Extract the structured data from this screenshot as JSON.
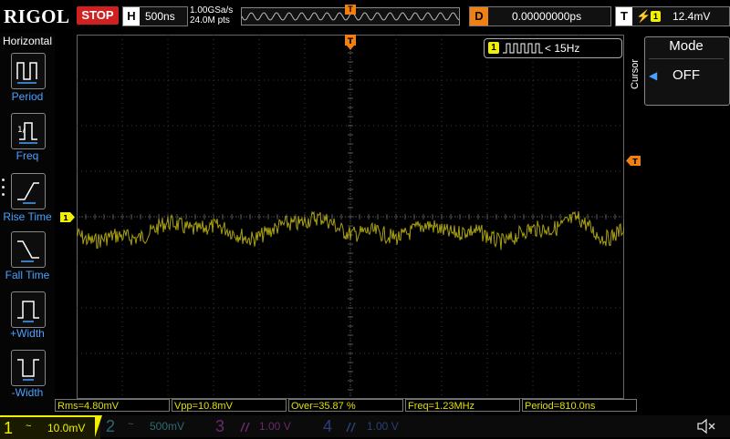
{
  "brand": "RIGOL",
  "run_state": "STOP",
  "timebase": {
    "key": "H",
    "value": "500ns"
  },
  "sampling": {
    "rate": "1.00GSa/s",
    "points": "24.0M pts"
  },
  "delay": {
    "key": "D",
    "value": "0.00000000ps"
  },
  "trigger": {
    "key": "T",
    "channel": "1",
    "level": "12.4mV",
    "marker": "T",
    "edge_glyph": "⚡"
  },
  "left_menu": {
    "title": "Horizontal",
    "items": [
      {
        "label": "Period"
      },
      {
        "label": "Freq"
      },
      {
        "label": "Rise Time"
      },
      {
        "label": "Fall Time"
      },
      {
        "label": "+Width"
      },
      {
        "label": "-Width"
      }
    ]
  },
  "cursor_panel": {
    "tab": "Cursor",
    "mode_label": "Mode",
    "mode_value": "OFF"
  },
  "measure_indicator": {
    "channel": "1",
    "value": "< 15Hz"
  },
  "ch1_marker": "1",
  "measurements": [
    {
      "text": "Rms=4.80mV"
    },
    {
      "text": "Vpp=10.8mV"
    },
    {
      "text": "Over=35.87 %"
    },
    {
      "text": "Freq=1.23MHz"
    },
    {
      "text": "Period=810.0ns"
    }
  ],
  "channels": [
    {
      "num": "1",
      "coupling": "~",
      "scale": "10.0mV"
    },
    {
      "num": "2",
      "coupling": "~",
      "scale": "500mV"
    },
    {
      "num": "3",
      "coupling": "",
      "scale": "1.00 V"
    },
    {
      "num": "4",
      "coupling": "",
      "scale": "1.00 V"
    }
  ],
  "colors": {
    "ch1": "#f0f000",
    "trace": "#a8a010",
    "grid": "#3a3a3a",
    "accent_blue": "#4aa0ff",
    "trigger_orange": "#f08010",
    "stop_red": "#d02020"
  },
  "icons": {
    "speaker": "speaker-mute-icon"
  }
}
